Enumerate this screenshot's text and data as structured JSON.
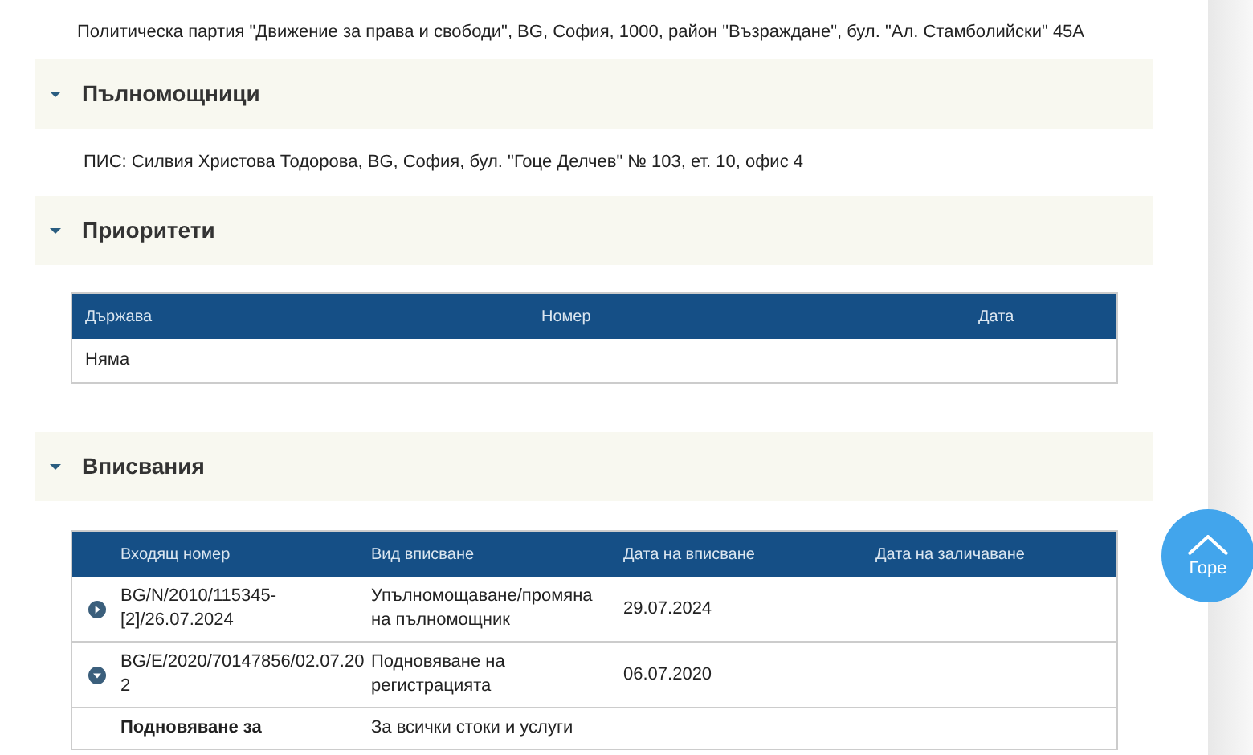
{
  "owner_text": "Политическа партия \"Движение за права и свободи\", BG, София, 1000, район \"Възраждане\", бул. \"Ал. Стамболийски\" 45А",
  "sections": [
    {
      "title": "Пълномощници",
      "expanded": true,
      "kind": "text",
      "text": "ПИС: Силвия Христова Тодорова, BG, София, бул. \"Гоце Делчев\" № 103, ет. 10, офис 4"
    },
    {
      "title": "Приоритети",
      "expanded": true,
      "kind": "table",
      "table": {
        "columns": [
          "Държава",
          "Номер",
          "Дата"
        ],
        "rows": [
          [
            "Няма"
          ]
        ]
      }
    },
    {
      "title": "Вписвания",
      "expanded": true,
      "kind": "entries",
      "table": {
        "columns": [
          "Входящ номер",
          "Вид вписване",
          "Дата на вписване",
          "Дата на заличаване"
        ],
        "rows": [
          {
            "expanded": false,
            "cells": [
              "BG/N/2010/115345-[2]/26.07.2024",
              "Упълномощаване/промяна на пълномощник",
              "29.07.2024"
            ]
          },
          {
            "expanded": true,
            "cells": [
              "BG/E/2020/70147856/02.07.202",
              "Подновяване на регистрацията",
              "06.07.2020"
            ],
            "details": [
              {
                "label": "Подновяване за",
                "value": "За всички стоки и услуги"
              }
            ]
          }
        ]
      }
    }
  ],
  "back_to_top": {
    "label": "Горе"
  }
}
